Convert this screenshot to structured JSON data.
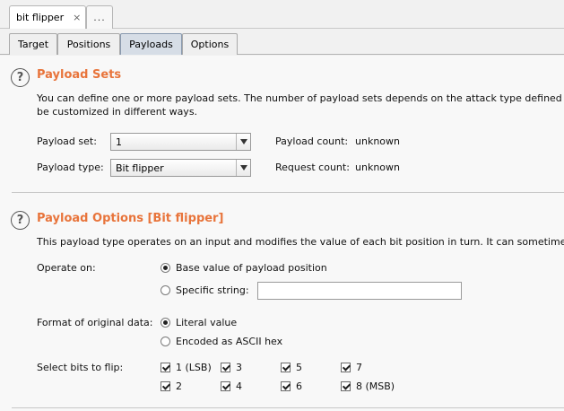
{
  "top_tabs": [
    {
      "label": "bit flipper",
      "close": "×"
    },
    {
      "label": "..."
    }
  ],
  "sub_tabs": [
    "Target",
    "Positions",
    "Payloads",
    "Options"
  ],
  "payload_sets": {
    "title": "Payload Sets",
    "description_line1": "You can define one or more payload sets. The number of payload sets depends on the attack type defined",
    "description_line2": "be customized in different ways.",
    "set_label": "Payload set:",
    "set_value": "1",
    "type_label": "Payload type:",
    "type_value": "Bit flipper",
    "payload_count_label": "Payload count:",
    "payload_count_value": "unknown",
    "request_count_label": "Request count:",
    "request_count_value": "unknown"
  },
  "payload_options": {
    "title": "Payload Options [Bit flipper]",
    "description": "This payload type operates on an input and modifies the value of each bit position in turn. It can sometime",
    "operate_label": "Operate on:",
    "operate_opt1": "Base value of payload position",
    "operate_opt2": "Specific string:",
    "specific_string_value": "",
    "format_label": "Format of original data:",
    "format_opt1": "Literal value",
    "format_opt2": "Encoded as ASCII hex",
    "bits_label": "Select bits to flip:",
    "bits": [
      "1 (LSB)",
      "2",
      "3",
      "4",
      "5",
      "6",
      "7",
      "8 (MSB)"
    ]
  }
}
